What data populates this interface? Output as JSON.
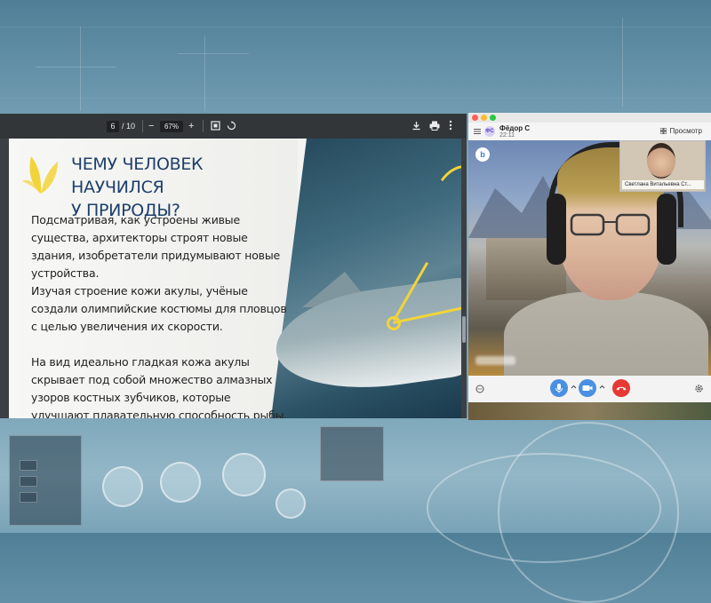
{
  "pdf_viewer": {
    "current_page": "6",
    "page_total": "/ 10",
    "zoom_minus": "−",
    "zoom_level": "67%",
    "zoom_plus": "+"
  },
  "slide": {
    "title_line1": "ЧЕМУ ЧЕЛОВЕК НАУЧИЛСЯ",
    "title_line2": "У ПРИРОДЫ?",
    "paragraphs": [
      "Подсматривая, как устроены живые существа, архитекторы строят новые здания, изобретатели придумывают новые устройства.",
      "Изучая строение кожи акулы, учёные создали олимпийские костюмы для пловцов с целью увеличения их скорости.",
      "На вид идеально гладкая кожа акулы скрывает под собой множество алмазных узоров костных зубчиков, которые улучшают плавательную способность рыбы."
    ],
    "accent_color": "#f2d43a",
    "title_color": "#1d3f6b"
  },
  "call": {
    "avatar_initials": "ФС",
    "caller_name": "Фёдор С",
    "call_time": "22:11",
    "view_label": "Просмотр",
    "badge": "b",
    "participant_thumbnail_name": "Светлана Витальевна Ст...",
    "mic_color": "#4a90e2",
    "camera_color": "#4a90e2",
    "hangup_color": "#e53935"
  }
}
